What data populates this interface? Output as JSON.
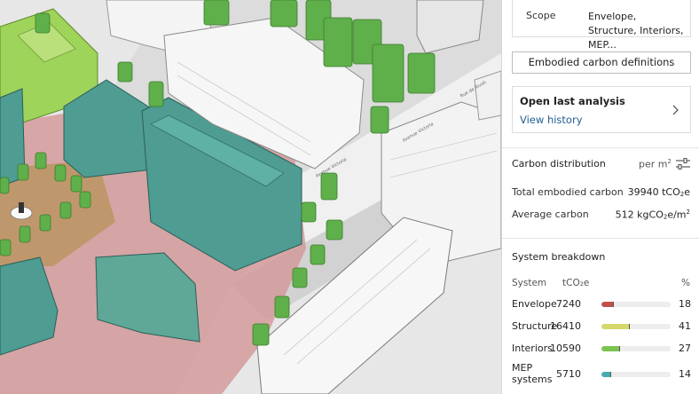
{
  "scope": {
    "label": "Scope",
    "value": "Envelope, Structure, Interiors, MEP..."
  },
  "definitions_button": "Embodied carbon definitions",
  "last_analysis": {
    "title": "Open last analysis",
    "link": "View history"
  },
  "carbon_distribution": {
    "title": "Carbon distribution",
    "per_unit_prefix": "per m",
    "per_unit_exp": "2",
    "total_label": "Total embodied carbon",
    "total_value": "39940 tCO",
    "total_sub": "2",
    "total_suffix": "e",
    "average_label": "Average carbon",
    "average_value": "512 kgCO",
    "average_sub": "2",
    "average_suffix": "e/m",
    "average_exp": "2"
  },
  "system_breakdown": {
    "title": "System breakdown",
    "col_system": "System",
    "col_tco2e": "tCO₂e",
    "col_pct": "%",
    "rows": [
      {
        "name": "Envelope",
        "value": "7240",
        "pct": "18",
        "fraction": 0.18,
        "color": "#c0504d"
      },
      {
        "name": "Structure",
        "value": "16410",
        "pct": "41",
        "fraction": 0.41,
        "color": "#d6d86b"
      },
      {
        "name": "Interiors",
        "value": "10590",
        "pct": "27",
        "fraction": 0.27,
        "color": "#7cc452"
      },
      {
        "name": "MEP systems",
        "value": "5710",
        "pct": "14",
        "fraction": 0.14,
        "color": "#4aa8b0"
      }
    ]
  },
  "map": {
    "street_labels": [
      "Avenue Victoria",
      "Avenue Victoria",
      "Rue de Rivoli"
    ],
    "colors": {
      "envelope": "#d49a9a",
      "structure_block": "#4e9c92",
      "interiors_block": "#9fd45a",
      "trees": "#5fb04a",
      "ground": "#e7e7e7"
    }
  }
}
